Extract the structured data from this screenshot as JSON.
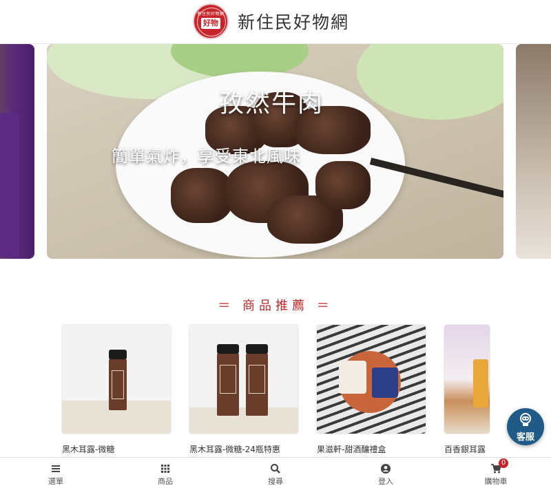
{
  "header": {
    "site_title": "新住民好物網",
    "logo_small": "新住民好物網",
    "logo_big": "好物"
  },
  "carousel": {
    "slide_title": "孜然牛肉",
    "slide_subtitle": "簡單氣炸，享受東北風味"
  },
  "section": {
    "title": "＝ 商品推薦 ＝"
  },
  "products": [
    {
      "name": "黑木耳露-微糖"
    },
    {
      "name": "黑木耳露-微糖-24瓶特惠"
    },
    {
      "name": "果滋軒-甜酒釀禮盒"
    },
    {
      "name": "百香銀耳露"
    }
  ],
  "chat": {
    "label": "客服"
  },
  "nav": {
    "menu": "選單",
    "products": "商品",
    "search": "搜尋",
    "login": "登入",
    "cart": "購物車",
    "cart_count": "0"
  },
  "colors": {
    "brand": "#c8242b",
    "chat": "#1f5b86",
    "section_title": "#b52a2a"
  }
}
